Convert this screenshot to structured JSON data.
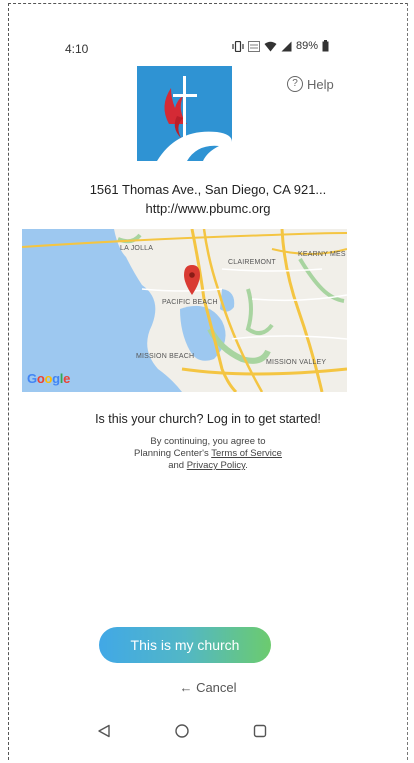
{
  "status_bar": {
    "time": "4:10",
    "battery": "89%"
  },
  "header": {
    "help_label": "Help"
  },
  "church": {
    "address": "1561 Thomas Ave., San Diego, CA 921...",
    "website": "http://www.pbumc.org"
  },
  "map": {
    "labels": {
      "la_jolla": "LA JOLLA",
      "clairemont": "CLAIREMONT",
      "kearny_mesa": "KEARNY MES",
      "pacific_beach": "PACIFIC BEACH",
      "mission_beach": "MISSION BEACH",
      "mission_valley": "MISSION VALLEY"
    },
    "provider": "Google"
  },
  "main": {
    "headline": "Is this your church? Log in to get started!",
    "legal_line1": "By continuing, you agree to",
    "legal_line2_prefix": "Planning Center's ",
    "terms_link": "Terms of Service",
    "legal_line3_prefix": "and ",
    "privacy_link": "Privacy Policy",
    "legal_line3_suffix": "."
  },
  "actions": {
    "confirm_label": "This is my church",
    "cancel_label": "← Cancel"
  },
  "colors": {
    "button_gradient_start": "#41a8e6",
    "button_gradient_end": "#6ccb6e",
    "logo_blue": "#2f93d3",
    "flame_red": "#d42a35",
    "map_water": "#9dc8f0",
    "map_land": "#f1efe9",
    "map_pin": "#d93a32"
  },
  "icons": {
    "help": "help-circle-icon",
    "back": "nav-back-icon",
    "home": "nav-home-icon",
    "recents": "nav-recents-icon"
  }
}
